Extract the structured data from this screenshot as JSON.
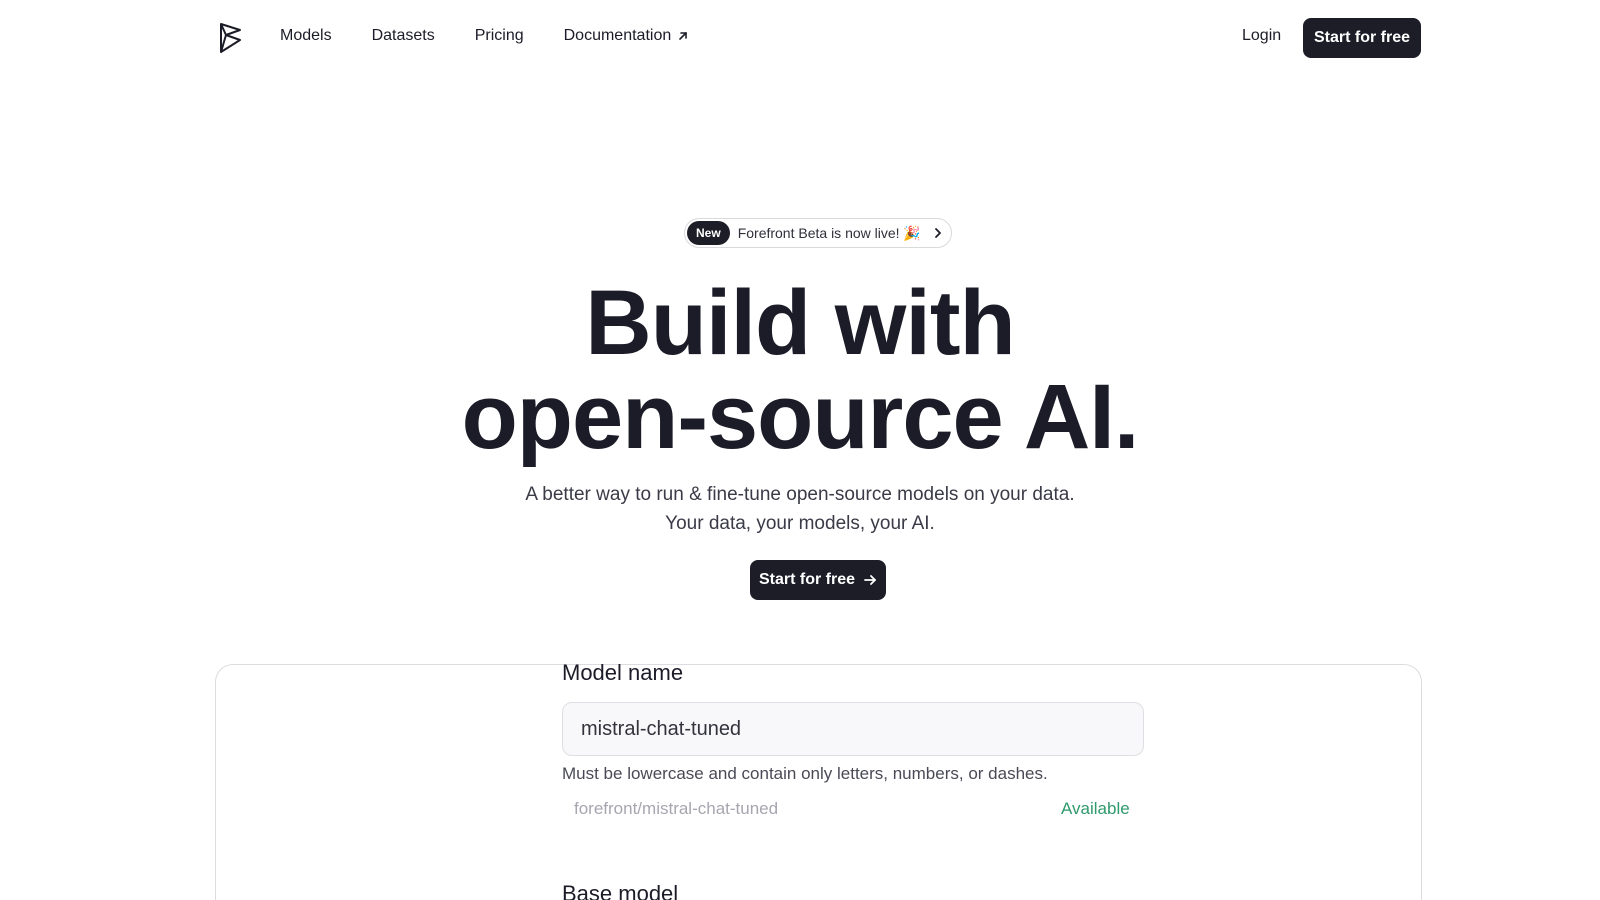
{
  "nav": {
    "links": [
      {
        "label": "Models"
      },
      {
        "label": "Datasets"
      },
      {
        "label": "Pricing"
      },
      {
        "label": "Documentation"
      }
    ],
    "login": "Login",
    "cta": "Start for free"
  },
  "badge": {
    "tag": "New",
    "text": "Forefront Beta is now live! 🎉"
  },
  "hero": {
    "title_line1": "Build with",
    "title_line2": "open-source AI.",
    "subtitle_line1": "A better way to run & fine-tune open-source models on your data.",
    "subtitle_line2": "Your data, your models, your AI.",
    "cta": "Start for free"
  },
  "form": {
    "model_name_label": "Model name",
    "model_name_value": "mistral-chat-tuned",
    "help": "Must be lowercase and contain only letters, numbers, or dashes.",
    "slug": "forefront/mistral-chat-tuned",
    "status": "Available",
    "base_model_label": "Base model"
  },
  "colors": {
    "primary": "#1c1d27",
    "success": "#2f9a6c",
    "border": "#dcdce0"
  }
}
